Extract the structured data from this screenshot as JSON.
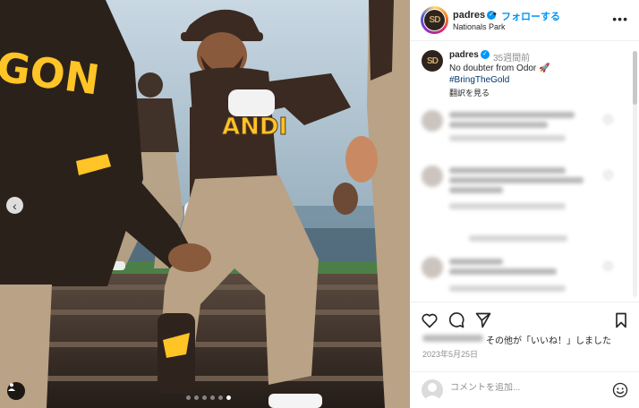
{
  "post": {
    "username": "padres",
    "separator": "•",
    "follow_label": "フォローする",
    "location": "Nationals Park",
    "avatar_text": "SD",
    "more_icon": "more-horizontal-icon",
    "verified_icon": "verified-badge-icon"
  },
  "caption": {
    "username": "padres",
    "time_ago": "35週間前",
    "text": "No doubter from Odor 🚀",
    "hashtag": "#BringTheGold",
    "translate_label": "翻訳を見る"
  },
  "carousel": {
    "prev_icon": "chevron-left-icon",
    "tag_icon": "user-tag-icon",
    "slide_count": 6,
    "active_index": 5
  },
  "photo": {
    "jersey_back": "GON",
    "jersey_front": "ANDI"
  },
  "actions": {
    "like_icon": "heart-icon",
    "comment_icon": "comment-icon",
    "share_icon": "send-icon",
    "save_icon": "bookmark-icon"
  },
  "likes": {
    "text": "その他が「いいね！」しました"
  },
  "date": "2023年5月25日",
  "comment_box": {
    "placeholder": "コメントを追加...",
    "emoji_icon": "smiley-icon"
  },
  "colors": {
    "accent": "#0095f6",
    "padres_brown": "#2f241d",
    "padres_gold": "#ffc425",
    "uniform_tan": "#b9a285"
  }
}
